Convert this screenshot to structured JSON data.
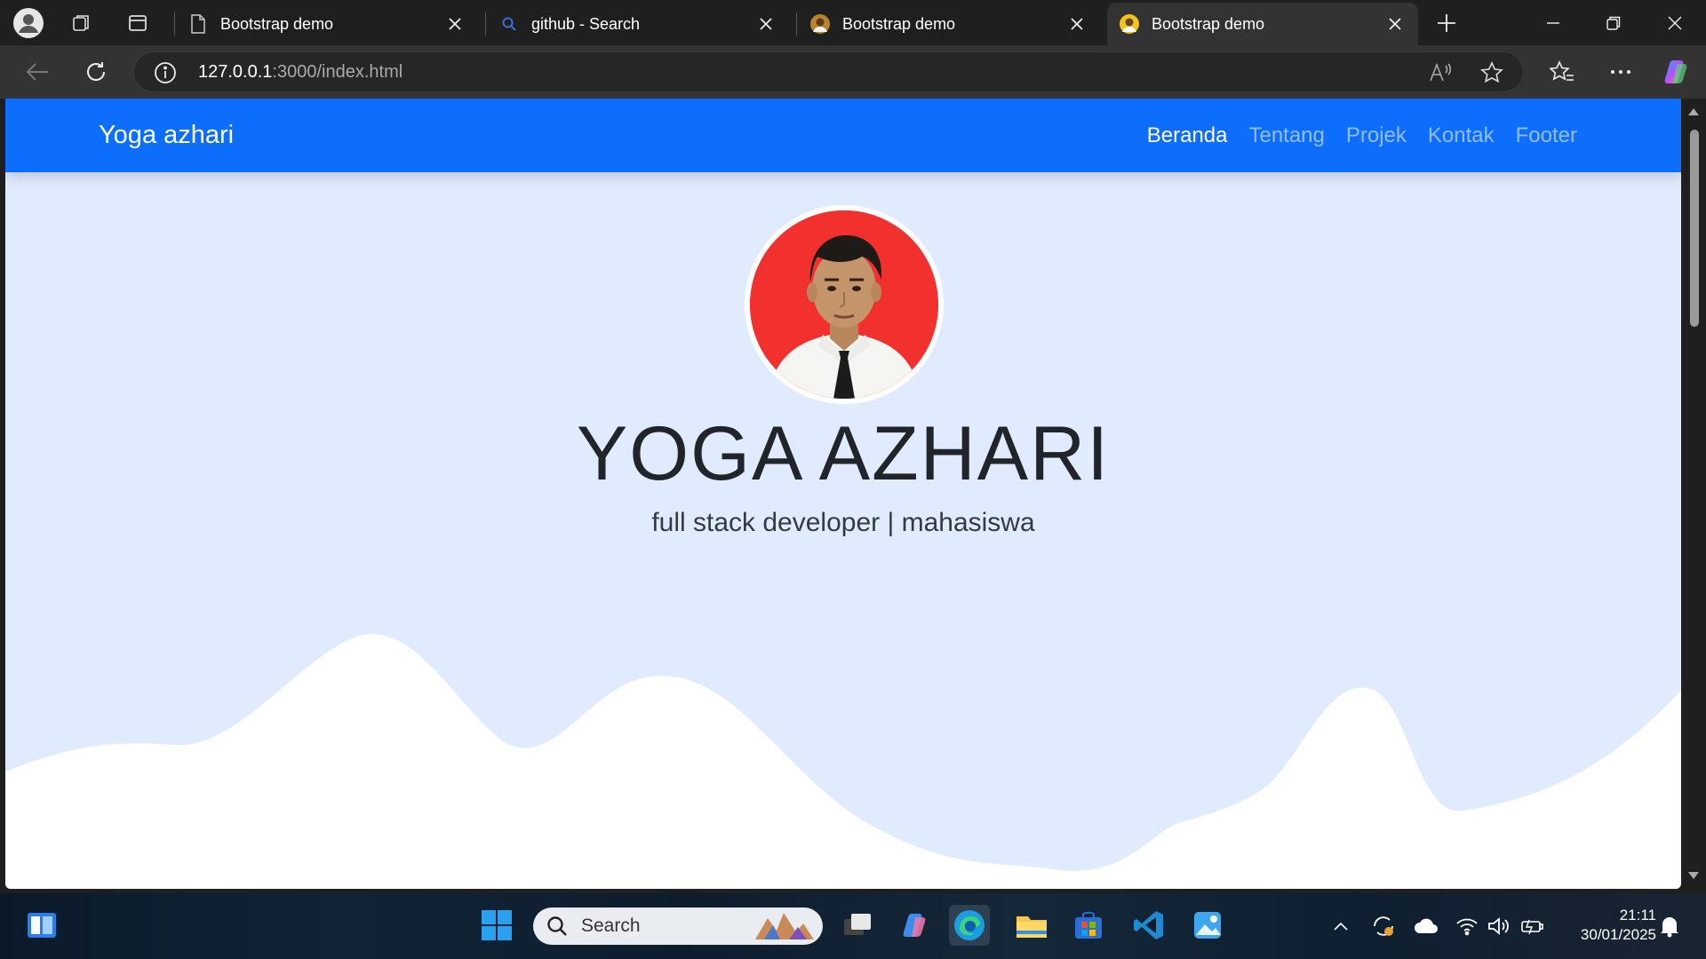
{
  "browser": {
    "tabs": [
      {
        "title": "Bootstrap demo",
        "icon": "page-icon",
        "active": false
      },
      {
        "title": "github - Search",
        "icon": "search-icon",
        "active": false
      },
      {
        "title": "Bootstrap demo",
        "icon": "avatar-favicon",
        "active": false
      },
      {
        "title": "Bootstrap demo",
        "icon": "avatar-favicon",
        "active": true
      }
    ],
    "address": {
      "host": "127.0.0.1",
      "rest": ":3000/index.html"
    }
  },
  "page": {
    "brand": "Yoga azhari",
    "nav": [
      {
        "label": "Beranda",
        "active": true
      },
      {
        "label": "Tentang",
        "active": false
      },
      {
        "label": "Projek",
        "active": false
      },
      {
        "label": "Kontak",
        "active": false
      },
      {
        "label": "Footer",
        "active": false
      }
    ],
    "hero": {
      "name": "YOGA AZHARI",
      "subtitle": "full stack developer | mahasiswa"
    },
    "colors": {
      "navbar": "#0d6efd",
      "hero_bg": "#e0ebff",
      "wave": "#ffffff"
    }
  },
  "taskbar": {
    "search_label": "Search",
    "time": "21:11",
    "date": "30/01/2025"
  }
}
